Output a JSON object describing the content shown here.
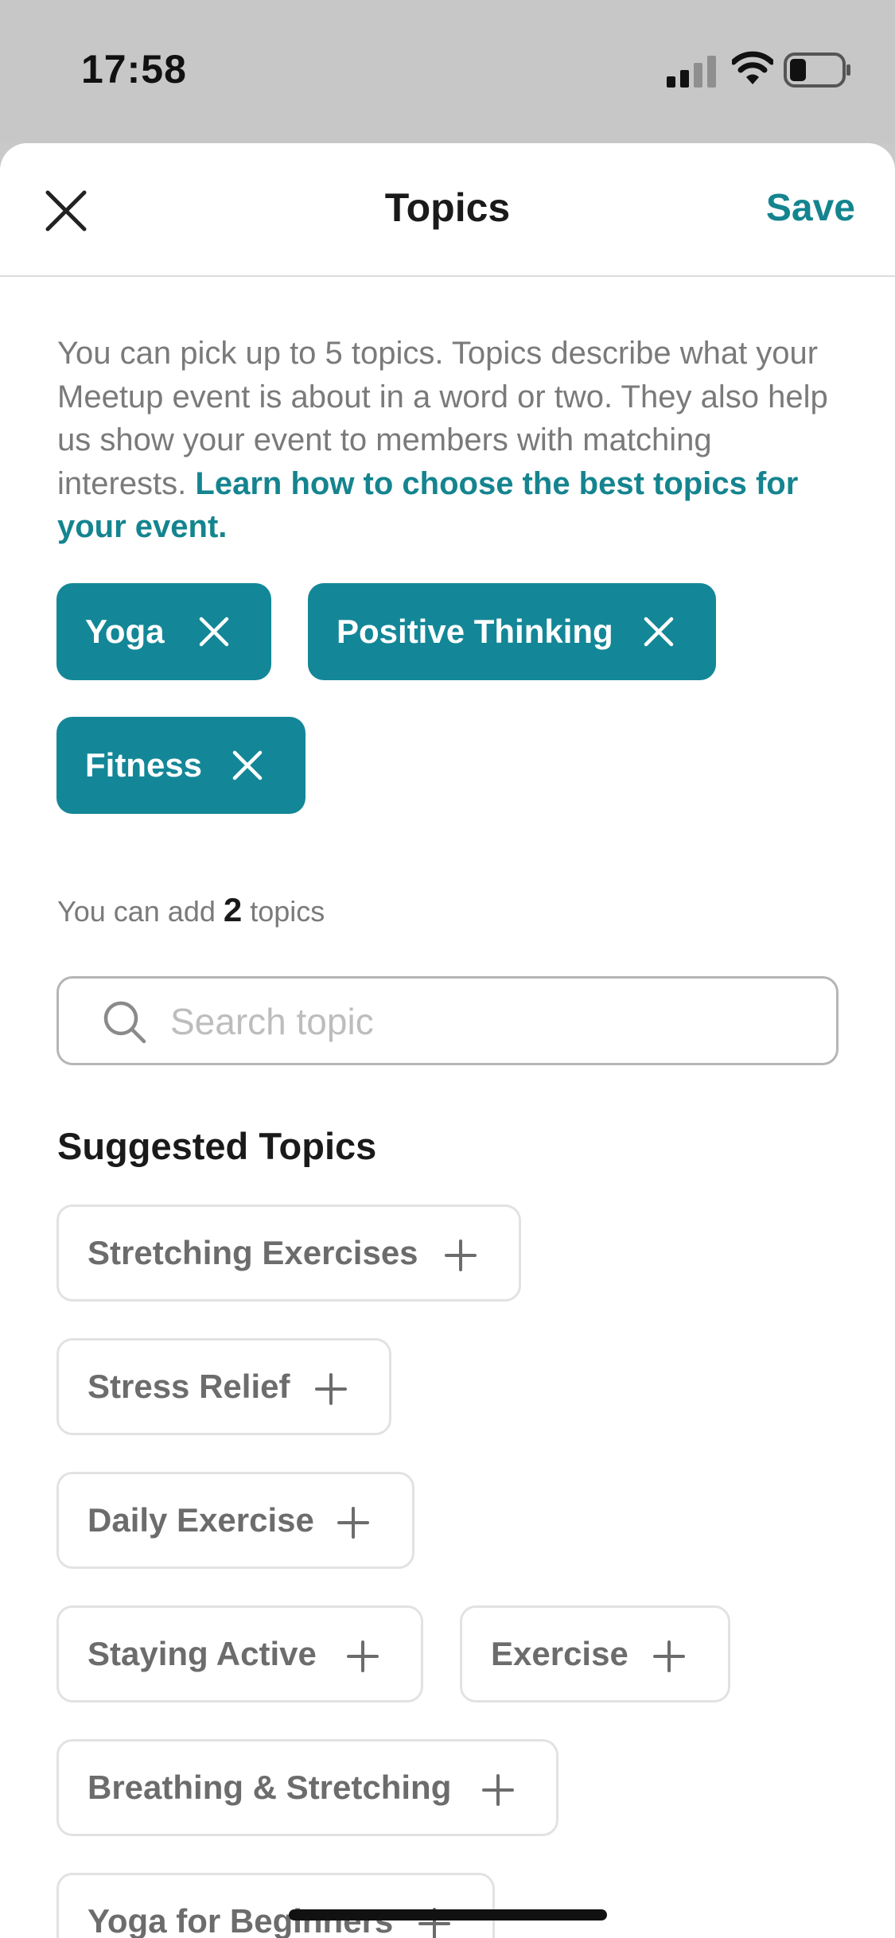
{
  "status_bar": {
    "time": "17:58"
  },
  "header": {
    "title": "Topics",
    "save_label": "Save"
  },
  "intro": {
    "text": "You can pick up to 5 topics. Topics describe what your Meetup event is about in a word or two. They also help us show your event to members with matching interests. ",
    "link": "Learn how to choose the best topics for your event."
  },
  "selected_topics": [
    "Yoga",
    "Positive Thinking",
    "Fitness"
  ],
  "counter": {
    "prefix": "You can add",
    "count": "2",
    "suffix": "topics"
  },
  "search": {
    "placeholder": "Search topic",
    "value": ""
  },
  "suggested": {
    "title": "Suggested Topics",
    "topics": [
      "Stretching Exercises",
      "Stress Relief",
      "Daily Exercise",
      "Staying Active",
      "Exercise",
      "Breathing & Stretching",
      "Yoga for Beginners"
    ]
  },
  "colors": {
    "accent": "#14848f",
    "chip_selected": "#138797"
  }
}
